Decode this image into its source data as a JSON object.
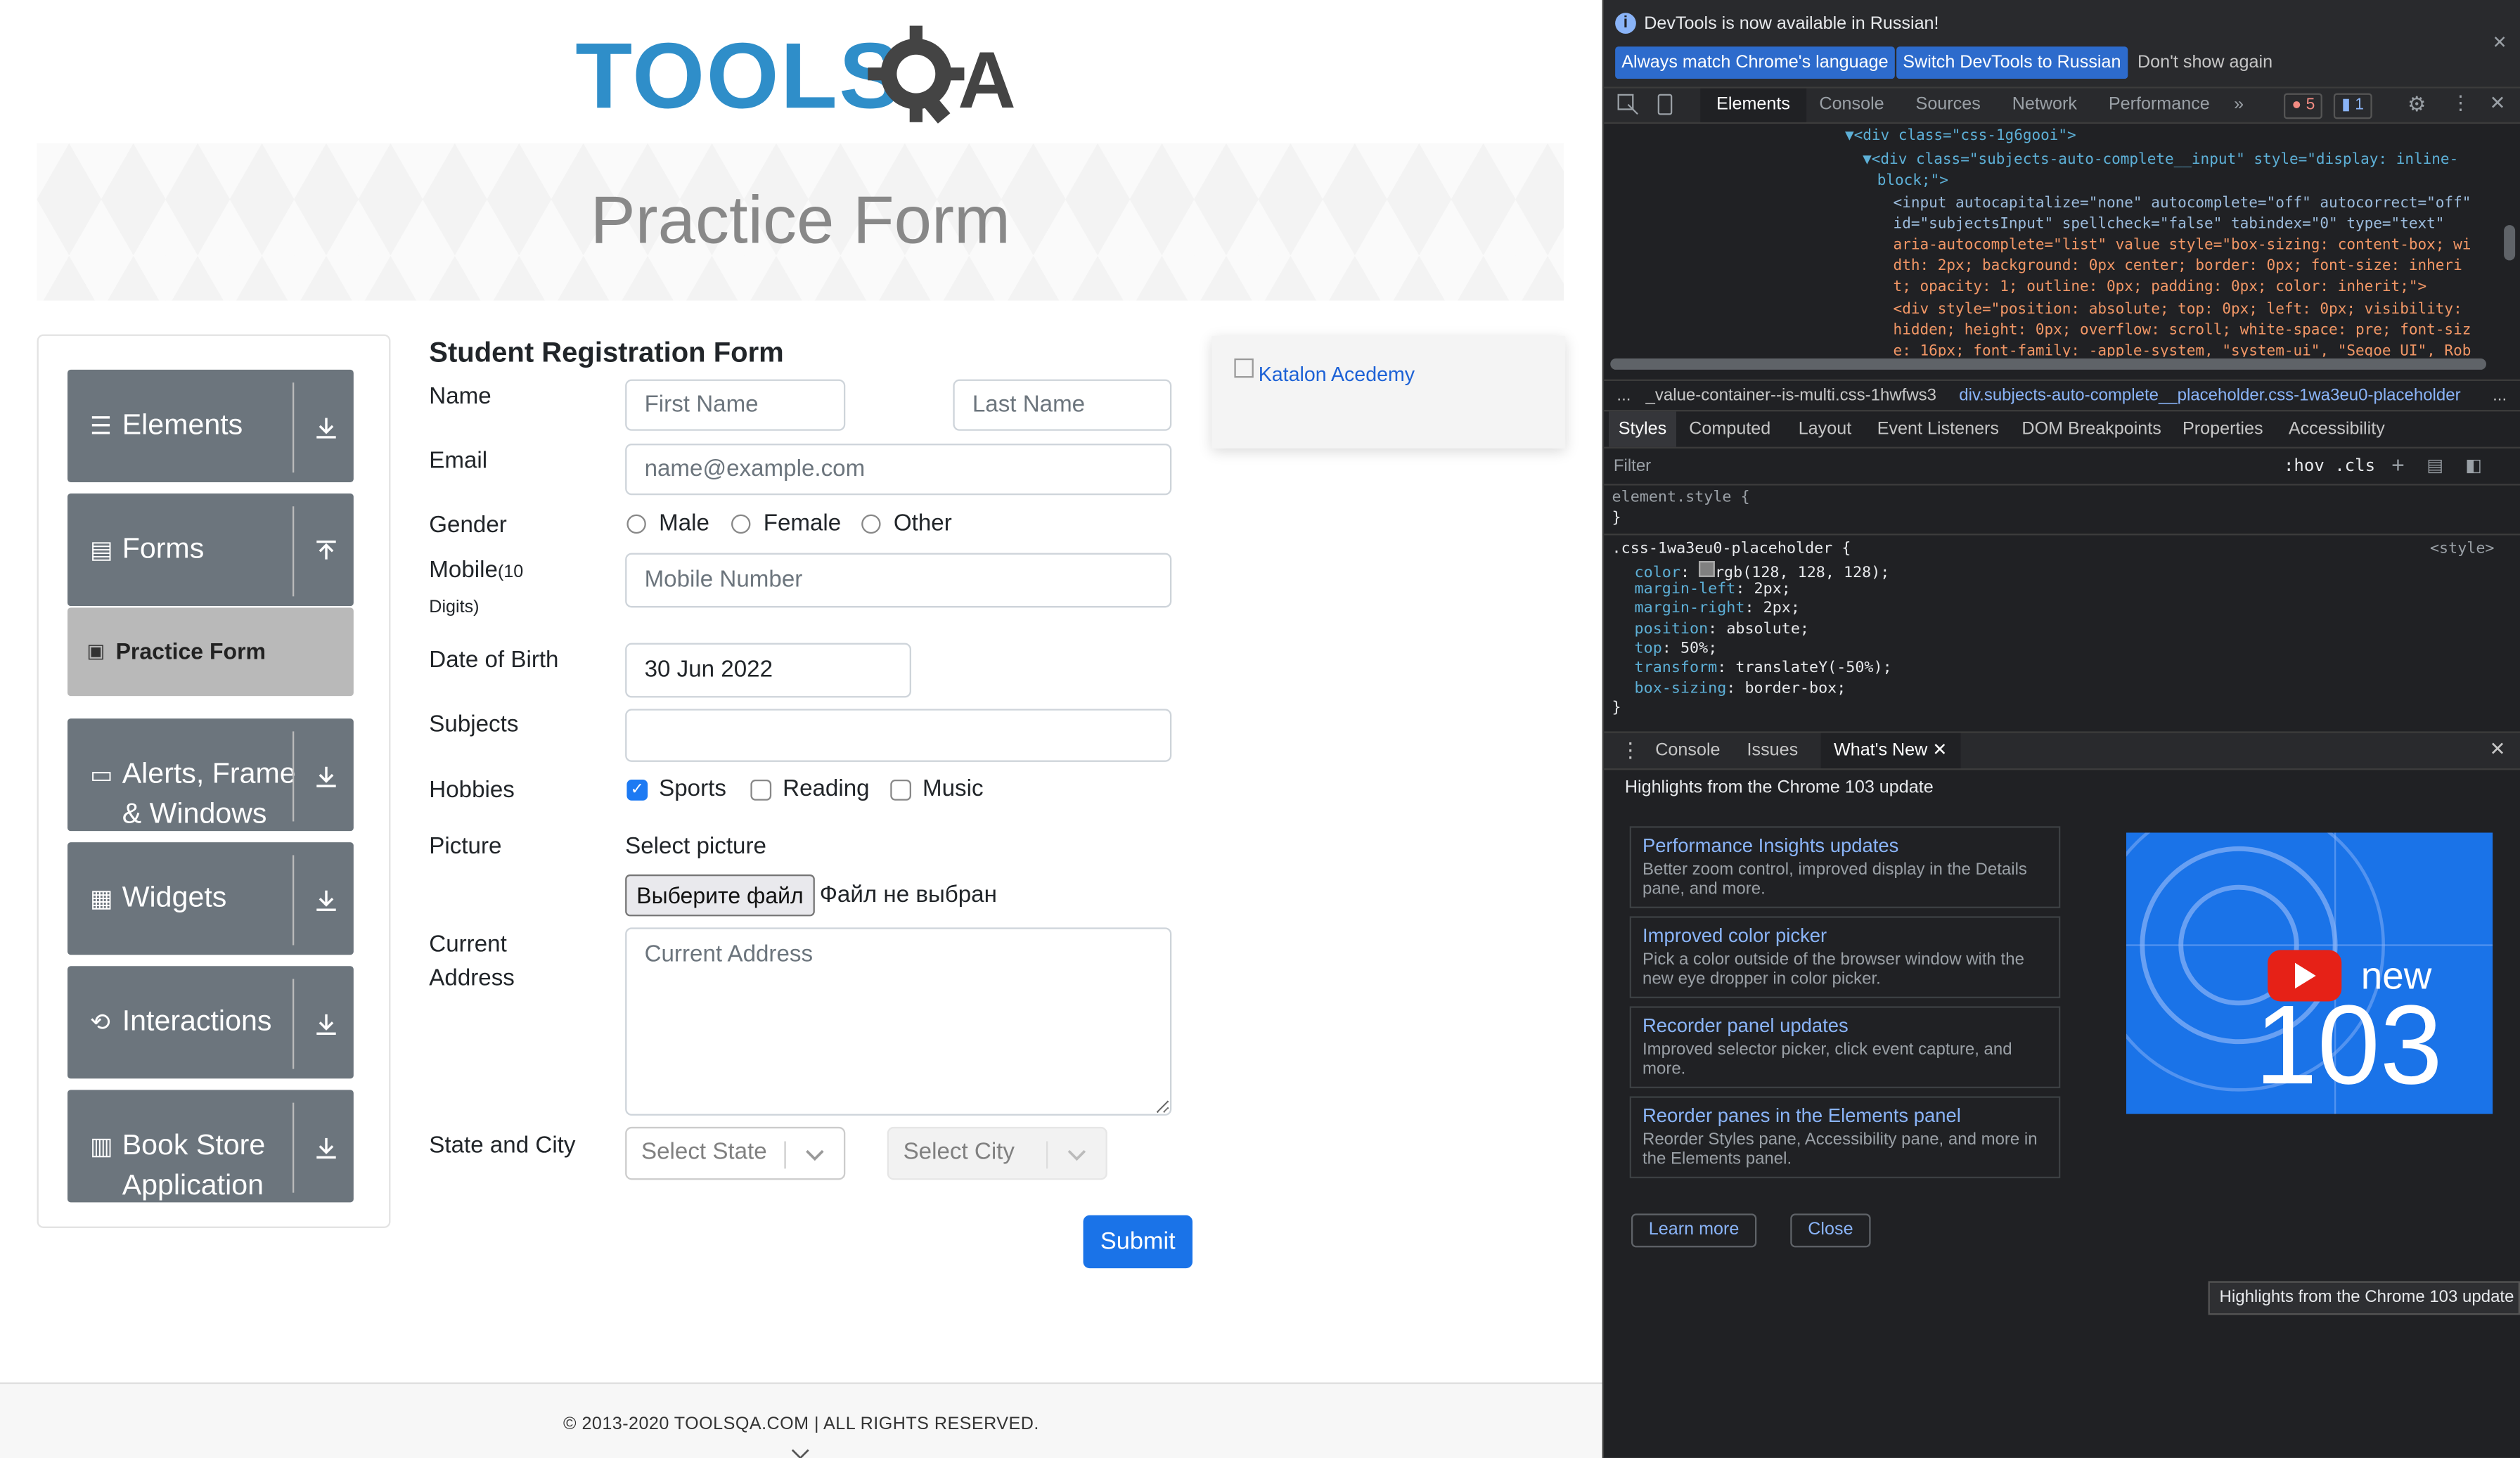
{
  "page": {
    "banner_title": "Practice Form",
    "logo_text": "TOOLSQA",
    "sidebar": {
      "groups": [
        {
          "label": "Elements",
          "icon": "hamburger-icon"
        },
        {
          "label": "Forms",
          "icon": "document-icon"
        },
        {
          "label_line1": "Alerts, Frame",
          "label_line2": "& Windows",
          "icon": "window-icon"
        },
        {
          "label": "Widgets",
          "icon": "grid-icon"
        },
        {
          "label": "Interactions",
          "icon": "interaction-icon"
        },
        {
          "label_line1": "Book Store",
          "label_line2": "Application",
          "icon": "books-icon"
        }
      ],
      "active_item": "Practice Form"
    },
    "form": {
      "title": "Student Registration Form",
      "name_label": "Name",
      "first_name_placeholder": "First Name",
      "last_name_placeholder": "Last Name",
      "email_label": "Email",
      "email_placeholder": "name@example.com",
      "gender_label": "Gender",
      "gender_options": [
        "Male",
        "Female",
        "Other"
      ],
      "mobile_label": "Mobile",
      "mobile_sub": "(10",
      "mobile_sub2": "Digits)",
      "mobile_placeholder": "Mobile Number",
      "dob_label": "Date of Birth",
      "dob_value": "30 Jun 2022",
      "subjects_label": "Subjects",
      "hobbies_label": "Hobbies",
      "hobbies": [
        {
          "label": "Sports",
          "checked": true
        },
        {
          "label": "Reading",
          "checked": false
        },
        {
          "label": "Music",
          "checked": false
        }
      ],
      "picture_label": "Picture",
      "picture_hint": "Select picture",
      "file_button": "Выберите файл",
      "file_status": "Файл не выбран",
      "address_label_line1": "Current",
      "address_label_line2": "Address",
      "address_placeholder": "Current Address",
      "state_city_label": "State and City",
      "state_placeholder": "Select State",
      "city_placeholder": "Select City",
      "submit": "Submit"
    },
    "ad_text": "Katalon Acedemy",
    "footer": "© 2013-2020 TOOLSQA.COM | ALL RIGHTS RESERVED."
  },
  "devtools": {
    "info_text": "DevTools is now available in Russian!",
    "info_buttons": [
      "Always match Chrome's language",
      "Switch DevTools to Russian",
      "Don't show again"
    ],
    "tabs": [
      "Elements",
      "Console",
      "Sources",
      "Network",
      "Performance"
    ],
    "active_tab": "Elements",
    "errors_count": "5",
    "messages_count": "1",
    "dom_lines": [
      "▼<div class=\"css-1g6gooi\">",
      "▼<div class=\"subjects-auto-complete__input\" style=\"display: inline-",
      "block;\">",
      "<input autocapitalize=\"none\" autocomplete=\"off\" autocorrect=\"off\"",
      "id=\"subjectsInput\" spellcheck=\"false\" tabindex=\"0\" type=\"text\"",
      "aria-autocomplete=\"list\" value style=\"box-sizing: content-box; wi",
      "dth: 2px; background: 0px center; border: 0px; font-size: inheri",
      "t; opacity: 1; outline: 0px; padding: 0px; color: inherit;\">",
      "<div style=\"position: absolute; top: 0px; left: 0px; visibility:",
      "hidden; height: 0px; overflow: scroll; white-space: pre; font-siz",
      "e: 16px; font-family: -apple-system, \"system-ui\", \"Segoe UI\", Rob"
    ],
    "breadcrumbs": [
      "...",
      "_value-container--is-multi.css-1hwfws3",
      "div.subjects-auto-complete__placeholder.css-1wa3eu0-placeholder",
      "..."
    ],
    "styles_tabs": [
      "Styles",
      "Computed",
      "Layout",
      "Event Listeners",
      "DOM Breakpoints",
      "Properties",
      "Accessibility"
    ],
    "filter_placeholder": "Filter",
    "hov_cls": ":hov  .cls",
    "css_rules": {
      "element_style": "element.style {",
      "close": "}",
      "selector": ".css-1wa3eu0-placeholder {",
      "source": "<style>",
      "props": [
        {
          "name": "color",
          "value": "rgb(128, 128, 128);"
        },
        {
          "name": "margin-left",
          "value": "2px;"
        },
        {
          "name": "margin-right",
          "value": "2px;"
        },
        {
          "name": "position",
          "value": "absolute;"
        },
        {
          "name": "top",
          "value": "50%;"
        },
        {
          "name": "transform",
          "value": "translateY(-50%);"
        },
        {
          "name": "box-sizing",
          "value": "border-box;"
        }
      ]
    },
    "drawer_tabs": [
      "Console",
      "Issues",
      "What's New"
    ],
    "whats_new_title": "Highlights from the Chrome 103 update",
    "cards": [
      {
        "title": "Performance Insights updates",
        "desc": "Better zoom control, improved display in the Details pane, and more."
      },
      {
        "title": "Improved color picker",
        "desc": "Pick a color outside of the browser window with the new eye dropper in color picker."
      },
      {
        "title": "Recorder panel updates",
        "desc": "Improved selector picker, click event capture, and more."
      },
      {
        "title": "Reorder panes in the Elements panel",
        "desc": "Reorder Styles pane, Accessibility pane, and more in the Elements panel."
      }
    ],
    "promo_new": "new",
    "promo_version": "103",
    "learn_more": "Learn more",
    "close": "Close",
    "tooltip": "Highlights from the Chrome 103 update"
  },
  "colors": {
    "primary": "#1a73e8",
    "sidebar": "#6c757d",
    "devtools_bg": "#202124"
  }
}
